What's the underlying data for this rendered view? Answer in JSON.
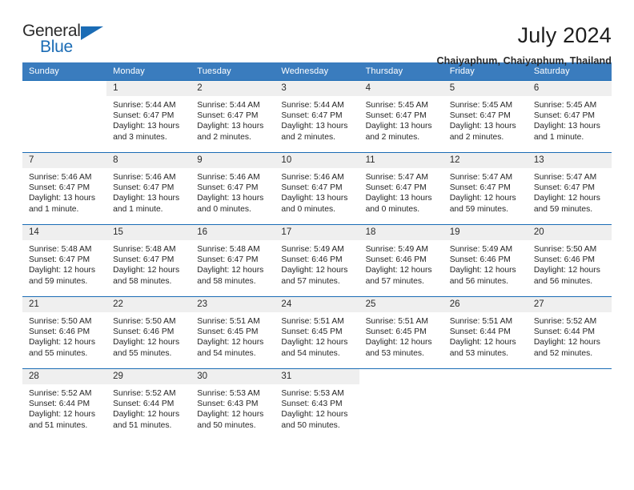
{
  "brand": {
    "name_part1": "General",
    "name_part2": "Blue",
    "accent_color": "#1b6cb5",
    "triangle_icon": "brand-triangle-icon"
  },
  "header": {
    "title": "July 2024",
    "location": "Chaiyaphum, Chaiyaphum, Thailand"
  },
  "calendar": {
    "header_bg": "#3a7cbe",
    "daynum_bg": "#efefef",
    "grid_line_color": "#1b6cb5",
    "weekdays": [
      "Sunday",
      "Monday",
      "Tuesday",
      "Wednesday",
      "Thursday",
      "Friday",
      "Saturday"
    ],
    "weeks": [
      [
        {
          "day": "",
          "lines": []
        },
        {
          "day": "1",
          "lines": [
            "Sunrise: 5:44 AM",
            "Sunset: 6:47 PM",
            "Daylight: 13 hours",
            "and 3 minutes."
          ]
        },
        {
          "day": "2",
          "lines": [
            "Sunrise: 5:44 AM",
            "Sunset: 6:47 PM",
            "Daylight: 13 hours",
            "and 2 minutes."
          ]
        },
        {
          "day": "3",
          "lines": [
            "Sunrise: 5:44 AM",
            "Sunset: 6:47 PM",
            "Daylight: 13 hours",
            "and 2 minutes."
          ]
        },
        {
          "day": "4",
          "lines": [
            "Sunrise: 5:45 AM",
            "Sunset: 6:47 PM",
            "Daylight: 13 hours",
            "and 2 minutes."
          ]
        },
        {
          "day": "5",
          "lines": [
            "Sunrise: 5:45 AM",
            "Sunset: 6:47 PM",
            "Daylight: 13 hours",
            "and 2 minutes."
          ]
        },
        {
          "day": "6",
          "lines": [
            "Sunrise: 5:45 AM",
            "Sunset: 6:47 PM",
            "Daylight: 13 hours",
            "and 1 minute."
          ]
        }
      ],
      [
        {
          "day": "7",
          "lines": [
            "Sunrise: 5:46 AM",
            "Sunset: 6:47 PM",
            "Daylight: 13 hours",
            "and 1 minute."
          ]
        },
        {
          "day": "8",
          "lines": [
            "Sunrise: 5:46 AM",
            "Sunset: 6:47 PM",
            "Daylight: 13 hours",
            "and 1 minute."
          ]
        },
        {
          "day": "9",
          "lines": [
            "Sunrise: 5:46 AM",
            "Sunset: 6:47 PM",
            "Daylight: 13 hours",
            "and 0 minutes."
          ]
        },
        {
          "day": "10",
          "lines": [
            "Sunrise: 5:46 AM",
            "Sunset: 6:47 PM",
            "Daylight: 13 hours",
            "and 0 minutes."
          ]
        },
        {
          "day": "11",
          "lines": [
            "Sunrise: 5:47 AM",
            "Sunset: 6:47 PM",
            "Daylight: 13 hours",
            "and 0 minutes."
          ]
        },
        {
          "day": "12",
          "lines": [
            "Sunrise: 5:47 AM",
            "Sunset: 6:47 PM",
            "Daylight: 12 hours",
            "and 59 minutes."
          ]
        },
        {
          "day": "13",
          "lines": [
            "Sunrise: 5:47 AM",
            "Sunset: 6:47 PM",
            "Daylight: 12 hours",
            "and 59 minutes."
          ]
        }
      ],
      [
        {
          "day": "14",
          "lines": [
            "Sunrise: 5:48 AM",
            "Sunset: 6:47 PM",
            "Daylight: 12 hours",
            "and 59 minutes."
          ]
        },
        {
          "day": "15",
          "lines": [
            "Sunrise: 5:48 AM",
            "Sunset: 6:47 PM",
            "Daylight: 12 hours",
            "and 58 minutes."
          ]
        },
        {
          "day": "16",
          "lines": [
            "Sunrise: 5:48 AM",
            "Sunset: 6:47 PM",
            "Daylight: 12 hours",
            "and 58 minutes."
          ]
        },
        {
          "day": "17",
          "lines": [
            "Sunrise: 5:49 AM",
            "Sunset: 6:46 PM",
            "Daylight: 12 hours",
            "and 57 minutes."
          ]
        },
        {
          "day": "18",
          "lines": [
            "Sunrise: 5:49 AM",
            "Sunset: 6:46 PM",
            "Daylight: 12 hours",
            "and 57 minutes."
          ]
        },
        {
          "day": "19",
          "lines": [
            "Sunrise: 5:49 AM",
            "Sunset: 6:46 PM",
            "Daylight: 12 hours",
            "and 56 minutes."
          ]
        },
        {
          "day": "20",
          "lines": [
            "Sunrise: 5:50 AM",
            "Sunset: 6:46 PM",
            "Daylight: 12 hours",
            "and 56 minutes."
          ]
        }
      ],
      [
        {
          "day": "21",
          "lines": [
            "Sunrise: 5:50 AM",
            "Sunset: 6:46 PM",
            "Daylight: 12 hours",
            "and 55 minutes."
          ]
        },
        {
          "day": "22",
          "lines": [
            "Sunrise: 5:50 AM",
            "Sunset: 6:46 PM",
            "Daylight: 12 hours",
            "and 55 minutes."
          ]
        },
        {
          "day": "23",
          "lines": [
            "Sunrise: 5:51 AM",
            "Sunset: 6:45 PM",
            "Daylight: 12 hours",
            "and 54 minutes."
          ]
        },
        {
          "day": "24",
          "lines": [
            "Sunrise: 5:51 AM",
            "Sunset: 6:45 PM",
            "Daylight: 12 hours",
            "and 54 minutes."
          ]
        },
        {
          "day": "25",
          "lines": [
            "Sunrise: 5:51 AM",
            "Sunset: 6:45 PM",
            "Daylight: 12 hours",
            "and 53 minutes."
          ]
        },
        {
          "day": "26",
          "lines": [
            "Sunrise: 5:51 AM",
            "Sunset: 6:44 PM",
            "Daylight: 12 hours",
            "and 53 minutes."
          ]
        },
        {
          "day": "27",
          "lines": [
            "Sunrise: 5:52 AM",
            "Sunset: 6:44 PM",
            "Daylight: 12 hours",
            "and 52 minutes."
          ]
        }
      ],
      [
        {
          "day": "28",
          "lines": [
            "Sunrise: 5:52 AM",
            "Sunset: 6:44 PM",
            "Daylight: 12 hours",
            "and 51 minutes."
          ]
        },
        {
          "day": "29",
          "lines": [
            "Sunrise: 5:52 AM",
            "Sunset: 6:44 PM",
            "Daylight: 12 hours",
            "and 51 minutes."
          ]
        },
        {
          "day": "30",
          "lines": [
            "Sunrise: 5:53 AM",
            "Sunset: 6:43 PM",
            "Daylight: 12 hours",
            "and 50 minutes."
          ]
        },
        {
          "day": "31",
          "lines": [
            "Sunrise: 5:53 AM",
            "Sunset: 6:43 PM",
            "Daylight: 12 hours",
            "and 50 minutes."
          ]
        },
        {
          "day": "",
          "lines": []
        },
        {
          "day": "",
          "lines": []
        },
        {
          "day": "",
          "lines": []
        }
      ]
    ]
  }
}
